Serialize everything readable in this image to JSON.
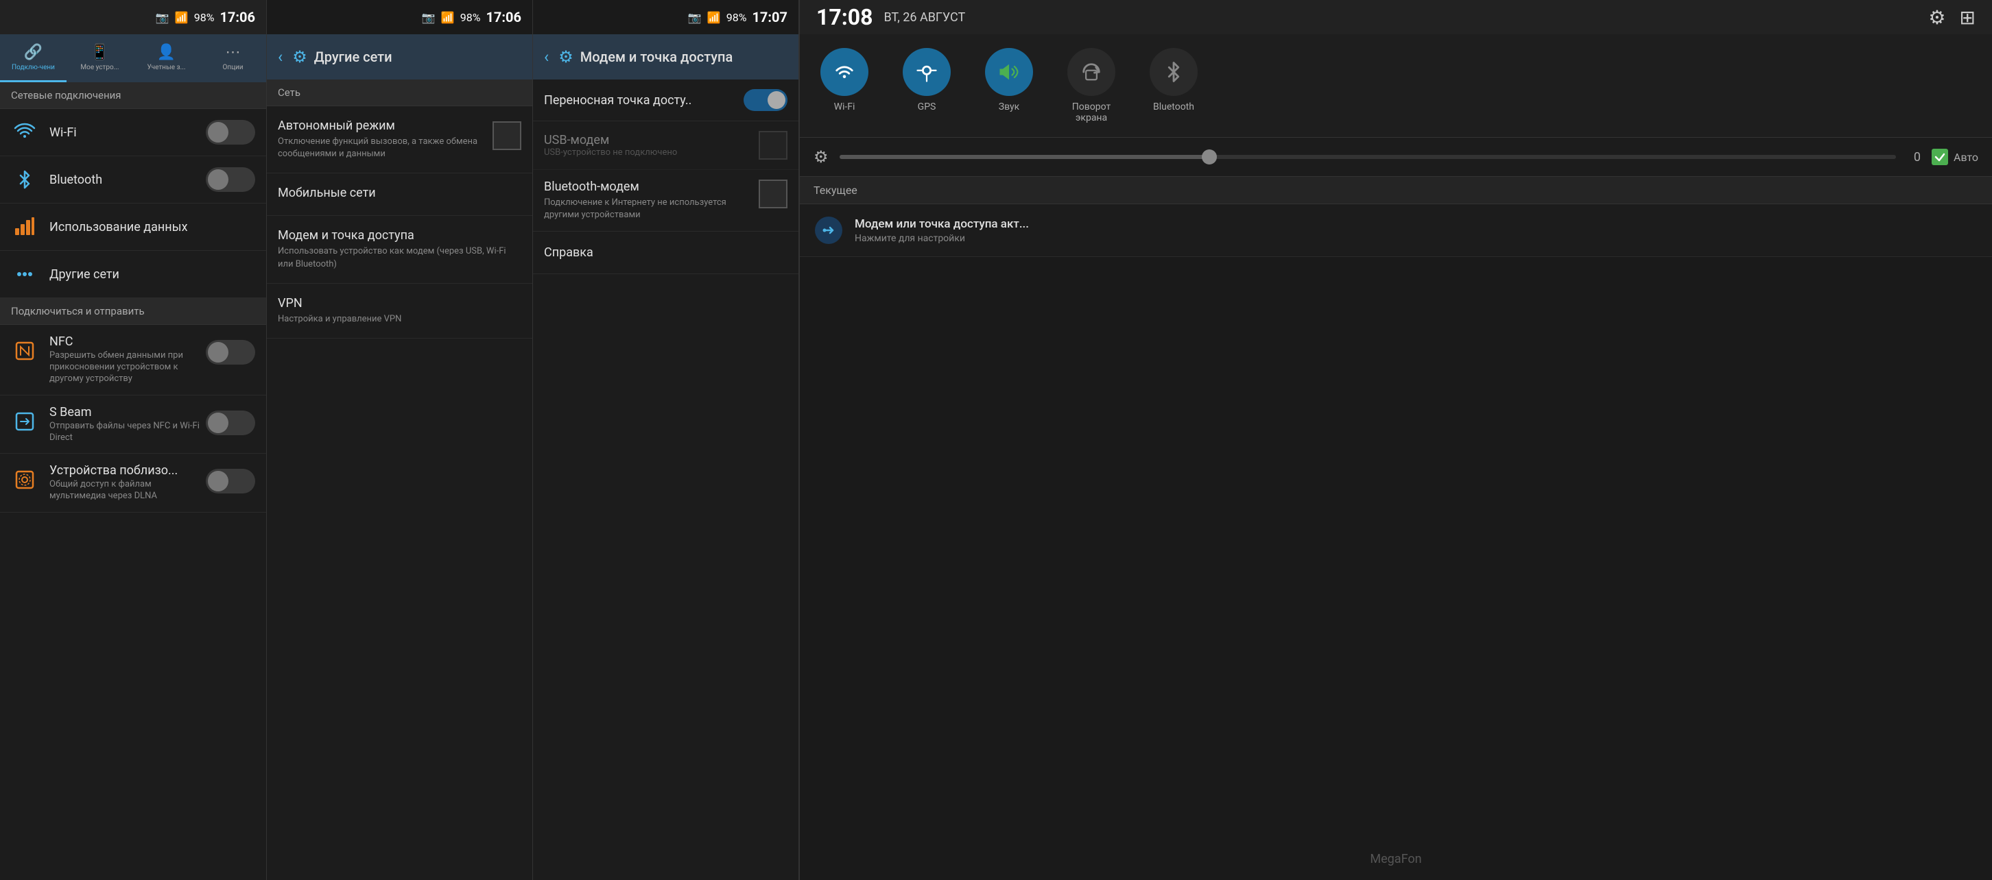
{
  "panel1": {
    "statusBar": {
      "signal": "▲",
      "battery": "98%",
      "time": "17:06",
      "cameraIcon": "📷"
    },
    "tabs": [
      {
        "id": "connections",
        "label": "Подклю-чени",
        "icon": "🔗",
        "active": true
      },
      {
        "id": "mydevice",
        "label": "Мое устро...",
        "icon": "📱",
        "active": false
      },
      {
        "id": "accounts",
        "label": "Учетные з...",
        "icon": "👤",
        "active": false
      },
      {
        "id": "options",
        "label": "Опции",
        "icon": "⋯",
        "active": false
      }
    ],
    "sectionHeader": "Сетевые подключения",
    "items": [
      {
        "id": "wifi",
        "title": "Wi-Fi",
        "hasToggle": true,
        "toggleOn": false
      },
      {
        "id": "bluetooth",
        "title": "Bluetooth",
        "hasToggle": true,
        "toggleOn": false
      }
    ],
    "section2Header": "Подключиться и отправить",
    "items2": [
      {
        "id": "nfc",
        "title": "NFC",
        "sub": "Разрешить обмен данными при прикосновении устройством к другому устройству",
        "hasToggle": true,
        "toggleOn": false
      },
      {
        "id": "sbeam",
        "title": "S Beam",
        "sub": "Отправить файлы через NFC и Wi-Fi Direct",
        "hasToggle": true,
        "toggleOn": false
      },
      {
        "id": "nearby",
        "title": "Устройства поблизо...",
        "sub": "Общий доступ к файлам мультимедиа через DLNA",
        "hasToggle": true,
        "toggleOn": false
      }
    ],
    "dataUsage": "Использование данных",
    "otherNetworks": "Другие сети"
  },
  "panel2": {
    "statusBar": {
      "battery": "98%",
      "time": "17:06",
      "cameraIcon": "📷"
    },
    "header": {
      "backLabel": "‹",
      "title": "Другие сети"
    },
    "sectionHeader": "Сеть",
    "items": [
      {
        "id": "airplane",
        "title": "Автономный режим",
        "sub": "Отключение функций вызовов, а также обмена сообщениями и данными",
        "hasCheckbox": true
      },
      {
        "id": "mobile",
        "title": "Мобильные сети",
        "sub": null,
        "hasCheckbox": false
      },
      {
        "id": "tethering",
        "title": "Модем и точка доступа",
        "sub": "Использовать устройство как модем (через USB, Wi-Fi или Bluetooth)",
        "hasCheckbox": false
      },
      {
        "id": "vpn",
        "title": "VPN",
        "sub": "Настройка и управление VPN",
        "hasCheckbox": false
      }
    ]
  },
  "panel3": {
    "statusBar": {
      "battery": "98%",
      "time": "17:07",
      "cameraIcon": "📷"
    },
    "header": {
      "backLabel": "‹",
      "title": "Модем и точка доступа"
    },
    "items": [
      {
        "id": "hotspot",
        "title": "Переносная точка досту..",
        "sub": null,
        "toggleOn": true
      },
      {
        "id": "usbmodem",
        "title": "USB-модем",
        "sub": "USB-устройство не подключено",
        "disabled": true
      },
      {
        "id": "btmodem",
        "title": "Bluetooth-модем",
        "sub": "Подключение к Интернету не используется другими устройствами",
        "hasCheckbox": true
      }
    ],
    "helpTitle": "Справка"
  },
  "panel4": {
    "statusBar": {
      "time": "17:08",
      "date": "ВТ, 26 АВГУСТ",
      "gearIcon": "⚙",
      "gridIcon": "⊞"
    },
    "quickToggles": [
      {
        "id": "wifi",
        "label": "Wi-Fi",
        "icon": "📶",
        "active": true
      },
      {
        "id": "gps",
        "label": "GPS",
        "icon": "◎",
        "active": true
      },
      {
        "id": "sound",
        "label": "Звук",
        "icon": "🔊",
        "active": true
      },
      {
        "id": "rotate",
        "label": "Поворот\nэкрана",
        "icon": "↺",
        "active": false
      },
      {
        "id": "bluetooth",
        "label": "Bluetooth",
        "icon": "ᛒ",
        "active": false
      }
    ],
    "brightness": {
      "value": "0",
      "autoLabel": "Авто",
      "fillPercent": 35
    },
    "sectionHeader": "Текущее",
    "notifications": [
      {
        "id": "tethering",
        "icon": "🔗",
        "title": "Модем или точка доступа акт...",
        "sub": "Нажмите для настройки"
      }
    ],
    "carrier": "MegaFon"
  }
}
